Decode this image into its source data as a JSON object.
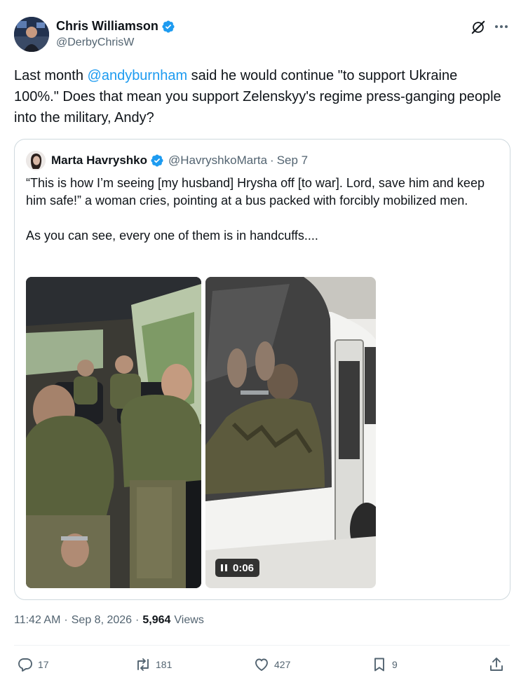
{
  "author": {
    "display_name": "Chris Williamson",
    "handle": "@DerbyChrisW"
  },
  "tweet": {
    "text_before": "Last month ",
    "mention": "@andyburnham",
    "text_after": " said he would continue \"to support Ukraine 100%.\" Does that mean you support Zelenskyy's regime press-ganging people into the military, Andy?"
  },
  "quote": {
    "display_name": "Marta Havryshko",
    "handle": "@HavryshkoMarta",
    "separator": "·",
    "date": "Sep 7",
    "text": "“This is how I’m seeing [my husband] Hrysha off [to war]. Lord, save him and keep him safe!” a woman cries, pointing at a bus packed with forcibly mobilized men.\n\nAs you can see, every one of them is in handcuffs....",
    "video_duration": "0:06"
  },
  "meta": {
    "time": "11:42 AM",
    "separator": "·",
    "date": "Sep 8, 2026",
    "views_count": "5,964",
    "views_label": "Views"
  },
  "actions": {
    "replies": "17",
    "reposts": "181",
    "likes": "427",
    "bookmarks": "9"
  },
  "colors": {
    "accent": "#1d9bf0",
    "text": "#0f1419",
    "secondary": "#536471",
    "border": "#cfd9de"
  }
}
